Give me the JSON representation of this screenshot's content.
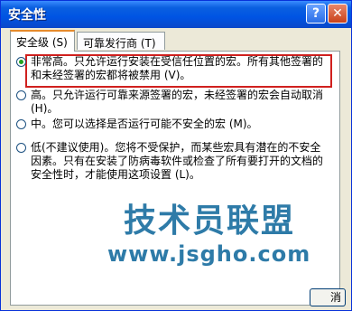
{
  "window": {
    "title": "安全性",
    "help_glyph": "?",
    "close_glyph": "✕"
  },
  "tabs": [
    {
      "label": "安全级 (S)"
    },
    {
      "label": "可靠发行商 (T)"
    }
  ],
  "options": [
    {
      "text": "非常高。只允许运行安装在受信任位置的宏。所有其他签署的和未经签署的宏都将被禁用 (V)。",
      "selected": true
    },
    {
      "text": "高。只允许运行可靠来源签署的宏，未经签署的宏会自动取消 (H)。",
      "selected": false
    },
    {
      "text": "中。您可以选择是否运行可能不安全的宏 (M)。",
      "selected": false
    },
    {
      "text": "低(不建议使用)。您将不受保护，而某些宏具有潜在的不安全因素。只有在安装了防病毒软件或检查了所有要打开的文档的安全性时，才能使用这项设置 (L)。",
      "selected": false
    }
  ],
  "watermark": {
    "brand": "技术员联盟",
    "url": "www.jsgho.com"
  },
  "footer": {
    "partial_button_label": "消"
  }
}
